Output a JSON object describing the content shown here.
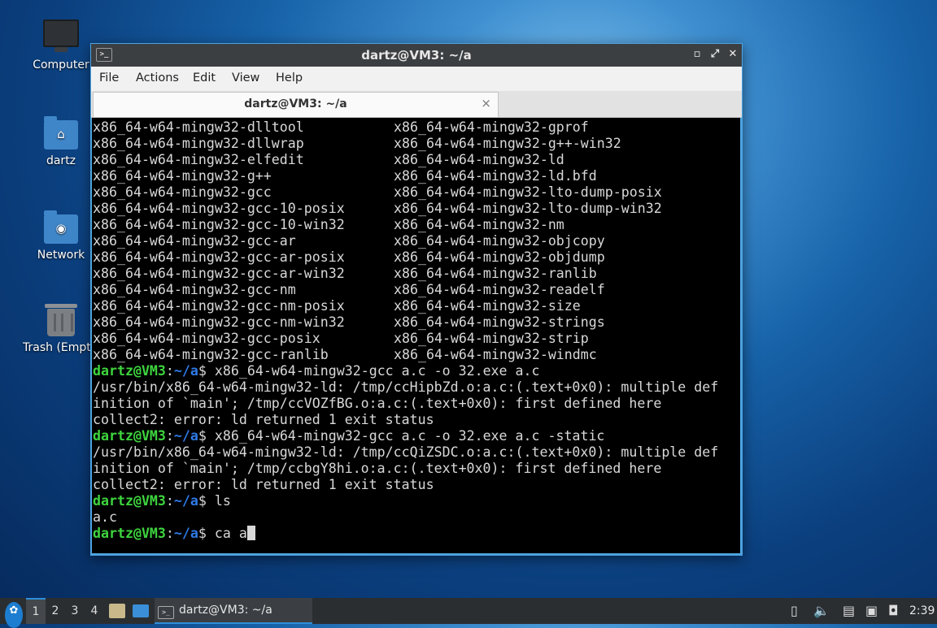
{
  "desktop": {
    "icons": [
      {
        "label": "Computer"
      },
      {
        "label": "dartz"
      },
      {
        "label": "Network"
      },
      {
        "label": "Trash (Empt"
      }
    ]
  },
  "window": {
    "title": "dartz@VM3: ~/a",
    "menu": [
      "File",
      "Actions",
      "Edit",
      "View",
      "Help"
    ],
    "tab_label": "dartz@VM3: ~/a",
    "tab_close": "×",
    "controls": {
      "minimize": "▫",
      "maximize": "⤢",
      "close": "✕"
    }
  },
  "terminal": {
    "listing": [
      [
        "x86_64-w64-mingw32-dlltool",
        "x86_64-w64-mingw32-gprof"
      ],
      [
        "x86_64-w64-mingw32-dllwrap",
        "x86_64-w64-mingw32-g++-win32"
      ],
      [
        "x86_64-w64-mingw32-elfedit",
        "x86_64-w64-mingw32-ld"
      ],
      [
        "x86_64-w64-mingw32-g++",
        "x86_64-w64-mingw32-ld.bfd"
      ],
      [
        "x86_64-w64-mingw32-gcc",
        "x86_64-w64-mingw32-lto-dump-posix"
      ],
      [
        "x86_64-w64-mingw32-gcc-10-posix",
        "x86_64-w64-mingw32-lto-dump-win32"
      ],
      [
        "x86_64-w64-mingw32-gcc-10-win32",
        "x86_64-w64-mingw32-nm"
      ],
      [
        "x86_64-w64-mingw32-gcc-ar",
        "x86_64-w64-mingw32-objcopy"
      ],
      [
        "x86_64-w64-mingw32-gcc-ar-posix",
        "x86_64-w64-mingw32-objdump"
      ],
      [
        "x86_64-w64-mingw32-gcc-ar-win32",
        "x86_64-w64-mingw32-ranlib"
      ],
      [
        "x86_64-w64-mingw32-gcc-nm",
        "x86_64-w64-mingw32-readelf"
      ],
      [
        "x86_64-w64-mingw32-gcc-nm-posix",
        "x86_64-w64-mingw32-size"
      ],
      [
        "x86_64-w64-mingw32-gcc-nm-win32",
        "x86_64-w64-mingw32-strings"
      ],
      [
        "x86_64-w64-mingw32-gcc-posix",
        "x86_64-w64-mingw32-strip"
      ],
      [
        "x86_64-w64-mingw32-gcc-ranlib",
        "x86_64-w64-mingw32-windmc"
      ]
    ],
    "prompt_user": "dartz@VM3",
    "prompt_sep": ":",
    "prompt_path": "~/a",
    "prompt_end": "$ ",
    "session": [
      {
        "cmd": "x86_64-w64-mingw32-gcc a.c -o 32.exe a.c",
        "out": [
          "/usr/bin/x86_64-w64-mingw32-ld: /tmp/ccHipbZd.o:a.c:(.text+0x0): multiple def",
          "inition of `main'; /tmp/ccVOZfBG.o:a.c:(.text+0x0): first defined here",
          "collect2: error: ld returned 1 exit status"
        ]
      },
      {
        "cmd": "x86_64-w64-mingw32-gcc a.c -o 32.exe a.c -static",
        "out": [
          "/usr/bin/x86_64-w64-mingw32-ld: /tmp/ccQiZSDC.o:a.c:(.text+0x0): multiple def",
          "inition of `main'; /tmp/ccbgY8hi.o:a.c:(.text+0x0): first defined here",
          "collect2: error: ld returned 1 exit status"
        ]
      },
      {
        "cmd": "ls",
        "out": [
          "a.c"
        ]
      }
    ],
    "current_input": "ca a"
  },
  "taskbar": {
    "start_icon": "start-menu-icon",
    "workspaces": [
      "1",
      "2",
      "3",
      "4"
    ],
    "active_workspace": "1",
    "task_label": "dartz@VM3: ~/a",
    "clock": "2:39"
  }
}
